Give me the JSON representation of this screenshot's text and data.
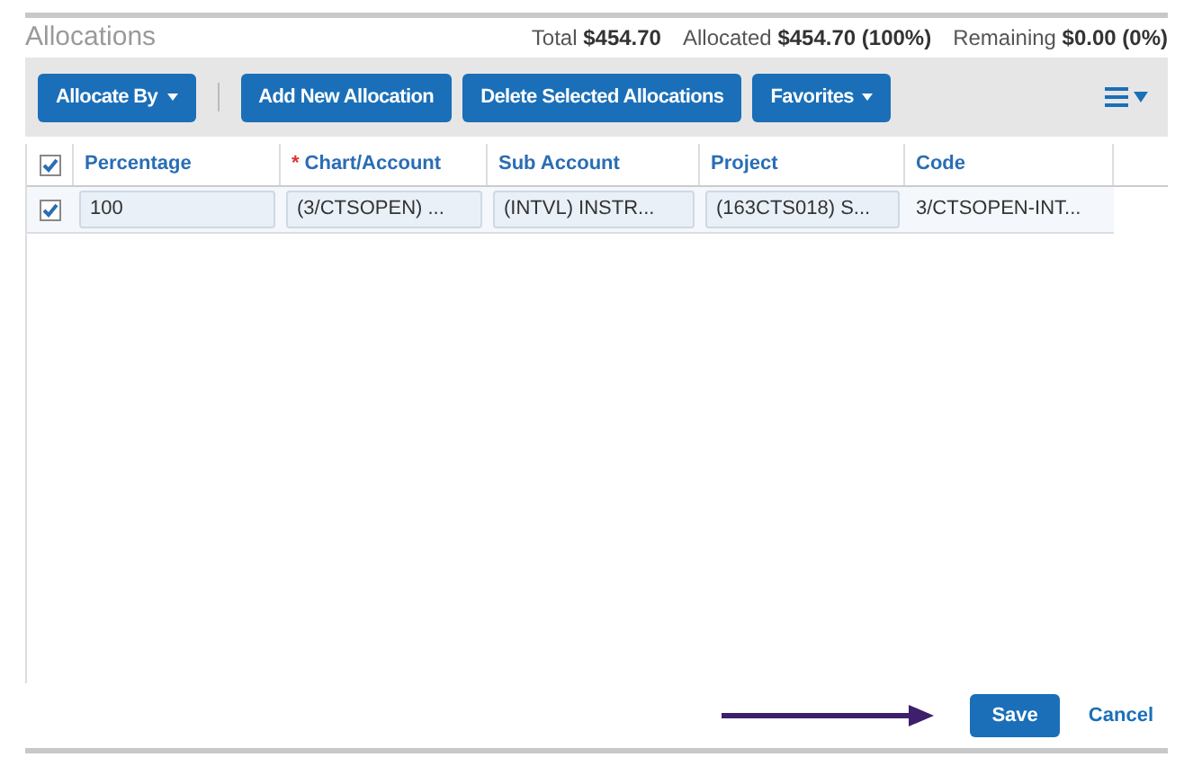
{
  "title": "Allocations",
  "summary": [
    {
      "label": "Total",
      "value": "$454.70"
    },
    {
      "label": "Allocated",
      "value": "$454.70 (100%)"
    },
    {
      "label": "Remaining",
      "value": "$0.00 (0%)"
    }
  ],
  "toolbar": [
    {
      "kind": "dropdown",
      "label": "Allocate By"
    },
    {
      "kind": "separator"
    },
    {
      "kind": "button",
      "label": "Add New Allocation"
    },
    {
      "kind": "button",
      "label": "Delete Selected Allocations"
    },
    {
      "kind": "dropdown",
      "label": "Favorites"
    }
  ],
  "table": {
    "select_all_checked": true,
    "columns": [
      {
        "label": "Percentage"
      },
      {
        "label": "Chart/Account",
        "required_mark": "*"
      },
      {
        "label": "Sub Account"
      },
      {
        "label": "Project"
      },
      {
        "label": "Code"
      }
    ],
    "rows": [
      {
        "checked": true,
        "cells": [
          {
            "kind": "field",
            "text": "100"
          },
          {
            "kind": "field",
            "text": "(3/CTSOPEN) ..."
          },
          {
            "kind": "field",
            "text": "(INTVL) INSTR..."
          },
          {
            "kind": "field",
            "text": "(163CTS018) S..."
          },
          {
            "kind": "text",
            "text": "3/CTSOPEN-INT..."
          }
        ]
      }
    ]
  },
  "footer": {
    "save": "Save",
    "cancel": "Cancel"
  }
}
